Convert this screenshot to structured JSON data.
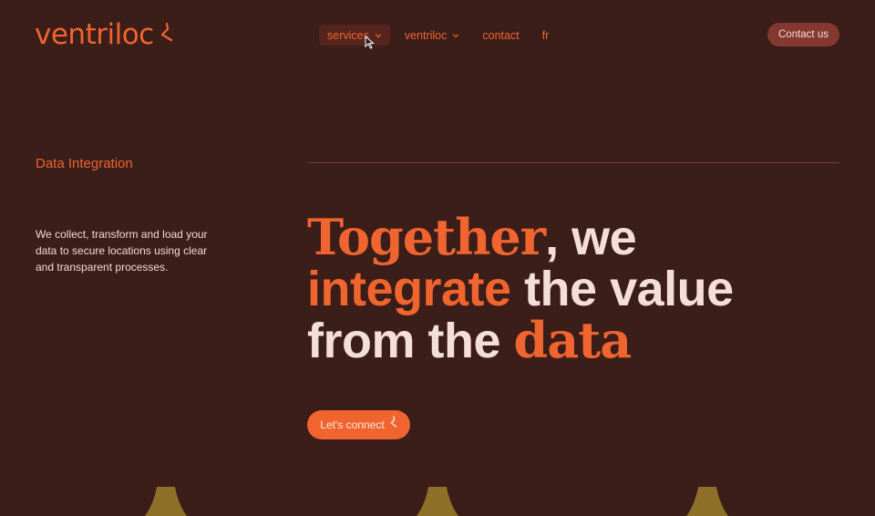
{
  "header": {
    "logo_text": "ventriloc",
    "nav": [
      {
        "label": "services",
        "icon": "chevron-down-icon"
      },
      {
        "label": "ventriloc",
        "icon": "chevron-down-icon"
      },
      {
        "label": "contact"
      },
      {
        "label": "fr"
      }
    ],
    "contact_button": "Contact us"
  },
  "main": {
    "section_title": "Data Integration",
    "description": "We collect, transform and load your data to secure locations using clear and transparent processes.",
    "headline": {
      "l1_a": "Together",
      "l1_b": ", we",
      "l2_a": "integrate",
      "l2_b": " the value",
      "l3_a": "from the ",
      "l3_b": "data"
    },
    "cta_label": "Let's connect"
  },
  "colors": {
    "background": "#3b1d19",
    "accent": "#f0652f",
    "button_dark": "#833930",
    "text_light": "#f4dfd6",
    "shape": "#8e7028"
  }
}
